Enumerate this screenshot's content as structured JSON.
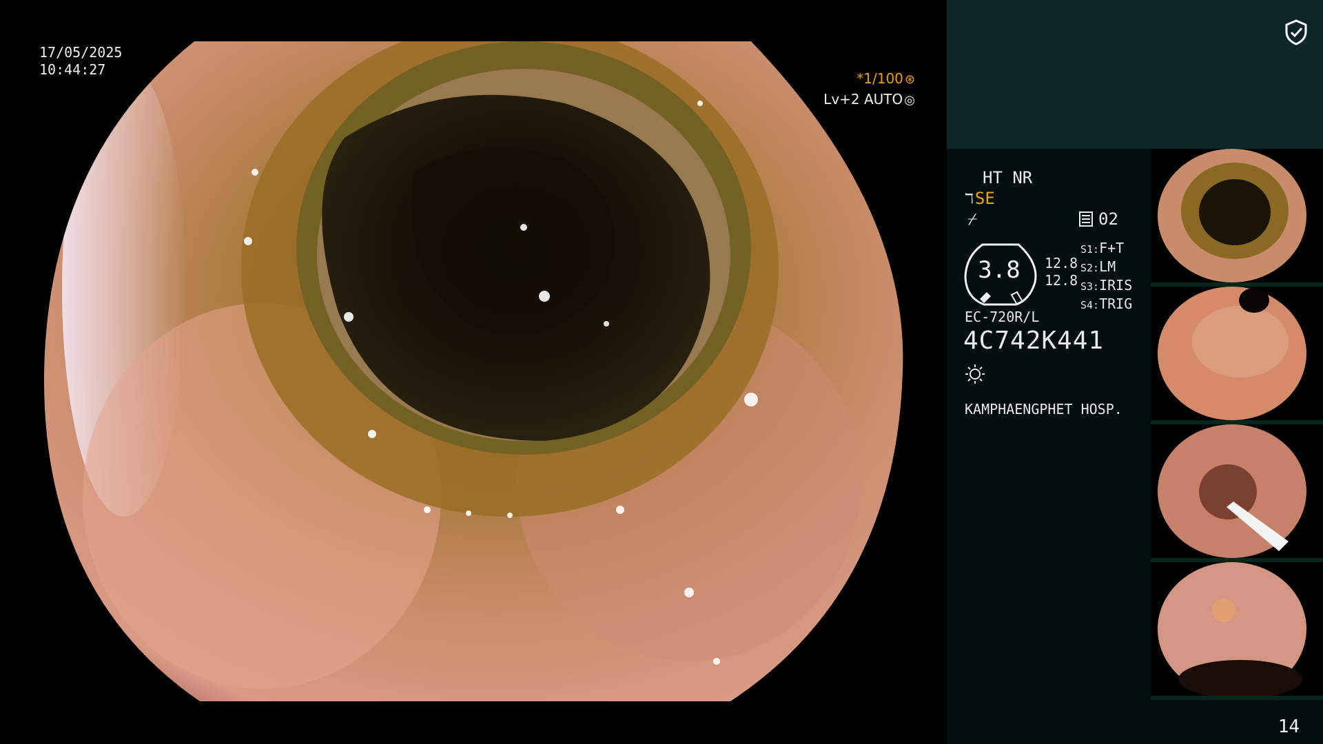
{
  "overlay": {
    "date": "17/05/2025",
    "time": "10:44:27",
    "zoom_top": "*1/100",
    "zoom_bottom": "Lv+2 AUTO"
  },
  "panel": {
    "mode": "HT NR",
    "structure_enhance": "SE",
    "memory": "02",
    "gauge_value": "3.8",
    "scale_values": [
      "12.8",
      "12.8"
    ],
    "switches": [
      {
        "key": "S1:",
        "value": "F+T"
      },
      {
        "key": "S2:",
        "value": "LM"
      },
      {
        "key": "S3:",
        "value": "IRIS"
      },
      {
        "key": "S4:",
        "value": "TRIG"
      }
    ],
    "scope_model": "EC-720R/L",
    "scope_serial": "4C742K441",
    "hospital": "KAMPHAENGPHET HOSP."
  },
  "thumbnails": [
    {
      "label": "capture-1"
    },
    {
      "label": "capture-2"
    },
    {
      "label": "capture-3"
    },
    {
      "label": "capture-4"
    }
  ],
  "page_number": "14",
  "colors": {
    "accent": "#f5a300",
    "banner_bg": "#0c2628",
    "panel_bg": "#020d0d",
    "thumb_bg": "#052018"
  },
  "icons": {
    "shield": "shield-check-icon",
    "brightness": "sun-icon",
    "zoom": "aperture-icon",
    "auto": "target-icon",
    "memory": "memory-icon",
    "se": "signal-icon",
    "wave": "wave-icon"
  }
}
